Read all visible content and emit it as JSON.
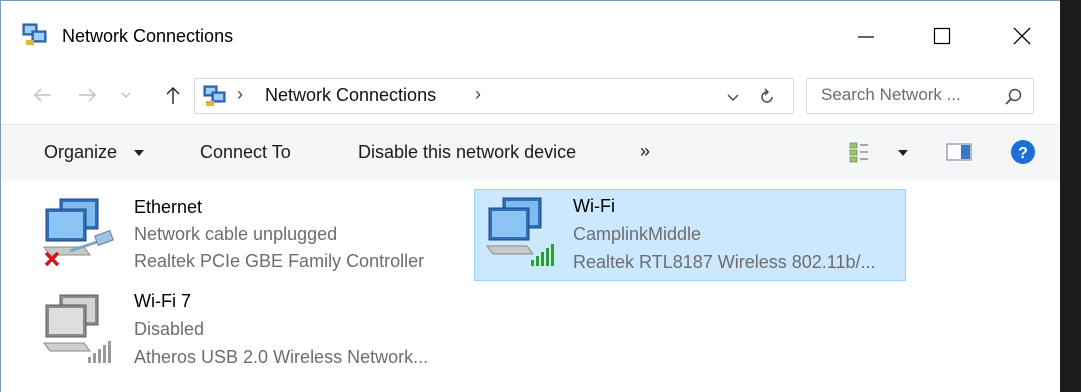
{
  "window": {
    "title": "Network Connections",
    "app_icon": "network-connections-icon",
    "controls": {
      "minimize": "minimize-icon",
      "maximize": "maximize-icon",
      "close": "close-icon"
    }
  },
  "address_bar": {
    "path_separator": "›",
    "path": "Network Connections",
    "trailing_separator": "›",
    "search_placeholder": "Search Network ..."
  },
  "toolbar": {
    "organize": "Organize",
    "connect_to": "Connect To",
    "disable_device": "Disable this network device",
    "more": "»"
  },
  "connections": [
    {
      "name": "Ethernet",
      "status": "Network cable unplugged",
      "device": "Realtek PCIe GBE Family Controller",
      "state_icon": "red-x-disconnected-icon",
      "selected": false
    },
    {
      "name": "Wi-Fi",
      "status": "CamplinkMiddle",
      "device": "Realtek RTL8187 Wireless 802.11b/...",
      "state_icon": "green-signal-bars-icon",
      "selected": true
    },
    {
      "name": "Wi-Fi 7",
      "status": "Disabled",
      "device": "Atheros USB 2.0 Wireless Network...",
      "state_icon": "gray-signal-bars-icon",
      "selected": false
    }
  ],
  "colors": {
    "selection_bg": "#cce8ff",
    "selection_border": "#99d1ff",
    "help_blue": "#1e6fd9",
    "signal_green": "#2aa12a"
  }
}
